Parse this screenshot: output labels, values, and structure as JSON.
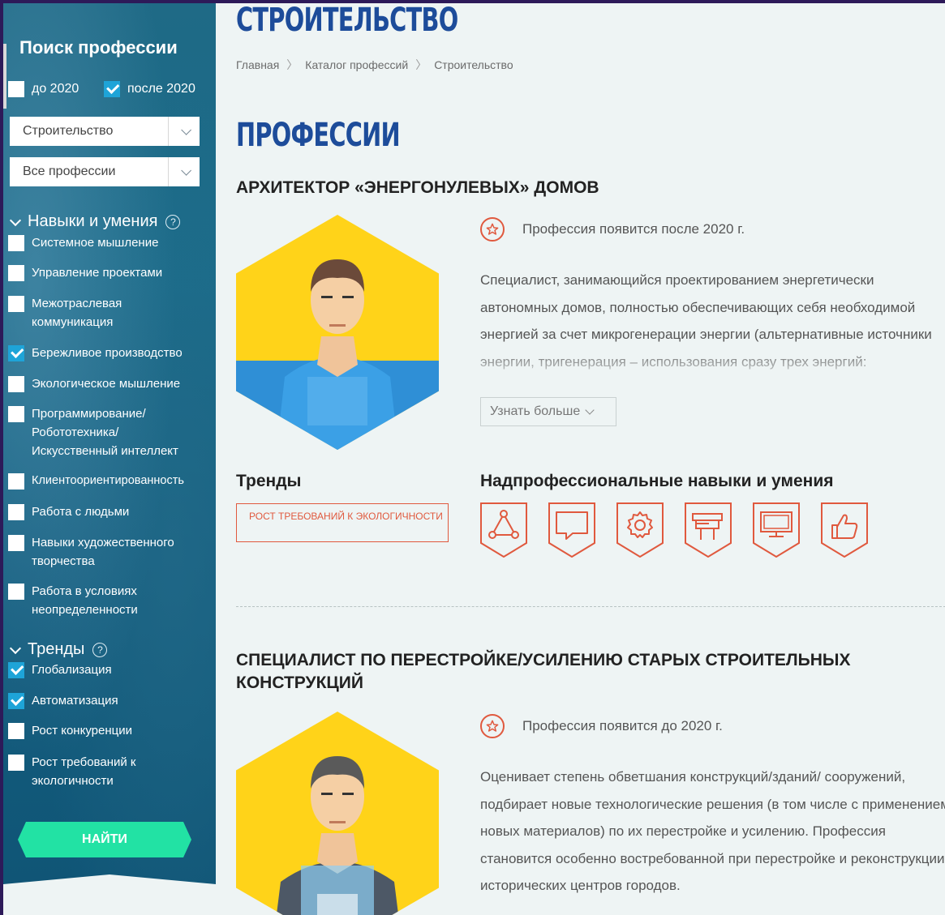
{
  "sidebar": {
    "title": "Поиск профессии",
    "years": [
      {
        "label": "до 2020",
        "checked": false
      },
      {
        "label": "после 2020",
        "checked": true
      }
    ],
    "industry_select": "Строительство",
    "profession_select": "Все профессии",
    "skills_section": {
      "title": "Навыки и умения",
      "help": "?",
      "items": [
        {
          "label": "Системное мышление",
          "checked": false
        },
        {
          "label": "Управление проектами",
          "checked": false
        },
        {
          "label": "Межотраслевая коммуникация",
          "checked": false
        },
        {
          "label": "Бережливое производство",
          "checked": true
        },
        {
          "label": "Экологическое мышление",
          "checked": false
        },
        {
          "label": "Программирование/ Робототехника/ Искусственный интеллект",
          "checked": false
        },
        {
          "label": "Клиентоориентированность",
          "checked": false
        },
        {
          "label": "Работа с людьми",
          "checked": false
        },
        {
          "label": "Навыки художественного творчества",
          "checked": false
        },
        {
          "label": "Работа в условиях неопределенности",
          "checked": false
        }
      ]
    },
    "trends_section": {
      "title": "Тренды",
      "help": "?",
      "items": [
        {
          "label": "Глобализация",
          "checked": true
        },
        {
          "label": "Автоматизация",
          "checked": true
        },
        {
          "label": "Рост конкуренции",
          "checked": false
        },
        {
          "label": "Рост требований к экологичности",
          "checked": false
        }
      ]
    },
    "find_button": "НАЙТИ"
  },
  "main": {
    "page_title": "СТРОИТЕЛЬСТВО",
    "breadcrumb": [
      "Главная",
      "Каталог профессий",
      "Строительство"
    ],
    "professions_title": "ПРОФЕССИИ",
    "professions": [
      {
        "title": "АРХИТЕКТОР «ЭНЕРГОНУЛЕВЫХ» ДОМОВ",
        "appears": "Профессия появится после 2020 г.",
        "description": "Специалист, занимающийся проектированием энергетически автономных домов, полностью обеспечивающих себя необходимой энергией за счет микрогенерации энергии (альтернативные источники энергии, тригенерация – использования сразу трех энергий: электричества, тепла и",
        "more": "Узнать больше",
        "trends_heading": "Тренды",
        "trend_tag": "РОСТ ТРЕБОВАНИЙ К ЭКОЛОГИЧНОСТИ",
        "skills_heading": "Надпрофессиональные навыки и умения",
        "skill_icons": [
          "network-icon",
          "speech-bubble-icon",
          "gear-icon",
          "tools-icon",
          "monitor-icon",
          "thumbs-up-icon"
        ]
      },
      {
        "title": "СПЕЦИАЛИСТ ПО ПЕРЕСТРОЙКЕ/УСИЛЕНИЮ СТАРЫХ СТРОИТЕЛЬНЫХ КОНСТРУКЦИЙ",
        "appears": "Профессия появится до 2020 г.",
        "description": "Оценивает степень обветшания конструкций/зданий/ сооружений, подбирает новые технологические решения (в том числе с применением новых материалов) по их перестройке и усилению. Профессия становится особенно востребованной при перестройке и реконструкции исторических центров городов."
      }
    ]
  },
  "colors": {
    "title_blue": "#1d4c9a",
    "accent_red": "#e0593e",
    "find_green": "#22e2a4",
    "check_blue": "#1ea4d8",
    "hex_yellow": "#ffd319"
  }
}
